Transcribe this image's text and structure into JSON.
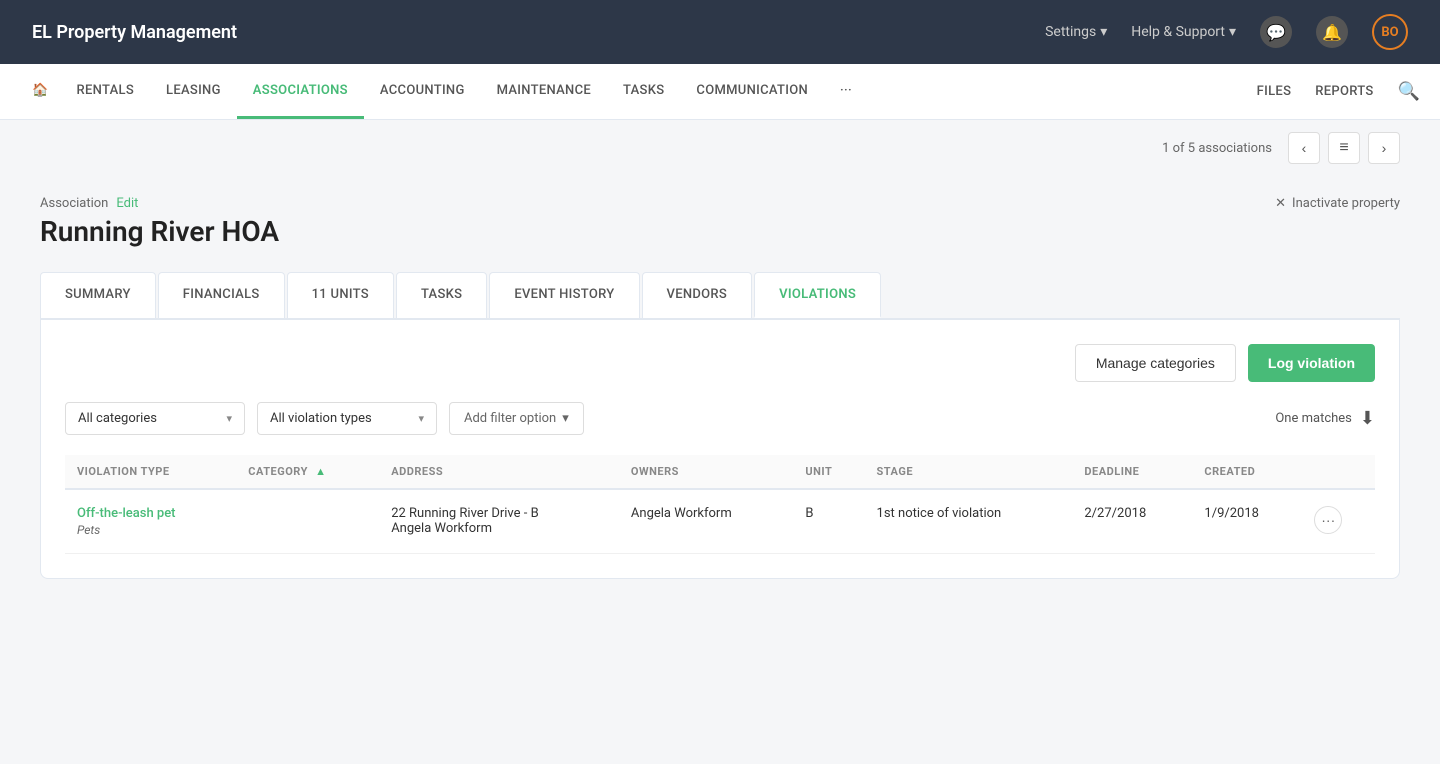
{
  "app": {
    "title": "EL Property Management"
  },
  "topnav": {
    "settings_label": "Settings",
    "help_label": "Help & Support",
    "chat_icon": "💬",
    "bell_icon": "🔔",
    "avatar_initials": "BO"
  },
  "secondnav": {
    "home_icon": "🏠",
    "links": [
      {
        "label": "RENTALS",
        "active": false
      },
      {
        "label": "LEASING",
        "active": false
      },
      {
        "label": "ASSOCIATIONS",
        "active": true
      },
      {
        "label": "ACCOUNTING",
        "active": false
      },
      {
        "label": "MAINTENANCE",
        "active": false
      },
      {
        "label": "TASKS",
        "active": false
      },
      {
        "label": "COMMUNICATION",
        "active": false
      },
      {
        "label": "···",
        "active": false
      }
    ],
    "right_links": [
      {
        "label": "FILES"
      },
      {
        "label": "REPORTS"
      }
    ]
  },
  "pagination": {
    "text": "1 of 5 associations"
  },
  "association": {
    "label": "Association",
    "edit_label": "Edit",
    "title": "Running River HOA",
    "inactivate_label": "Inactivate property"
  },
  "tabs": [
    {
      "label": "SUMMARY",
      "active": false
    },
    {
      "label": "FINANCIALS",
      "active": false
    },
    {
      "label": "11 UNITS",
      "active": false
    },
    {
      "label": "TASKS",
      "active": false
    },
    {
      "label": "EVENT HISTORY",
      "active": false
    },
    {
      "label": "VENDORS",
      "active": false
    },
    {
      "label": "VIOLATIONS",
      "active": true
    }
  ],
  "violations": {
    "manage_categories_label": "Manage categories",
    "log_violation_label": "Log violation",
    "filters": {
      "categories_placeholder": "All categories",
      "types_placeholder": "All violation types",
      "add_filter_label": "Add filter option"
    },
    "matches_text": "One matches",
    "table": {
      "columns": [
        {
          "label": "VIOLATION TYPE",
          "sortable": false
        },
        {
          "label": "CATEGORY",
          "sortable": true,
          "sort_dir": "asc"
        },
        {
          "label": "ADDRESS",
          "sortable": false
        },
        {
          "label": "OWNERS",
          "sortable": false
        },
        {
          "label": "UNIT",
          "sortable": false
        },
        {
          "label": "STAGE",
          "sortable": false
        },
        {
          "label": "DEADLINE",
          "sortable": false
        },
        {
          "label": "CREATED",
          "sortable": false
        }
      ],
      "rows": [
        {
          "violation_type": "Off-the-leash pet",
          "category": "Pets",
          "address": "22 Running River Drive - B",
          "owners": "Angela Workform",
          "unit": "B",
          "stage": "1st notice of violation",
          "deadline": "2/27/2018",
          "created": "1/9/2018"
        }
      ]
    }
  }
}
